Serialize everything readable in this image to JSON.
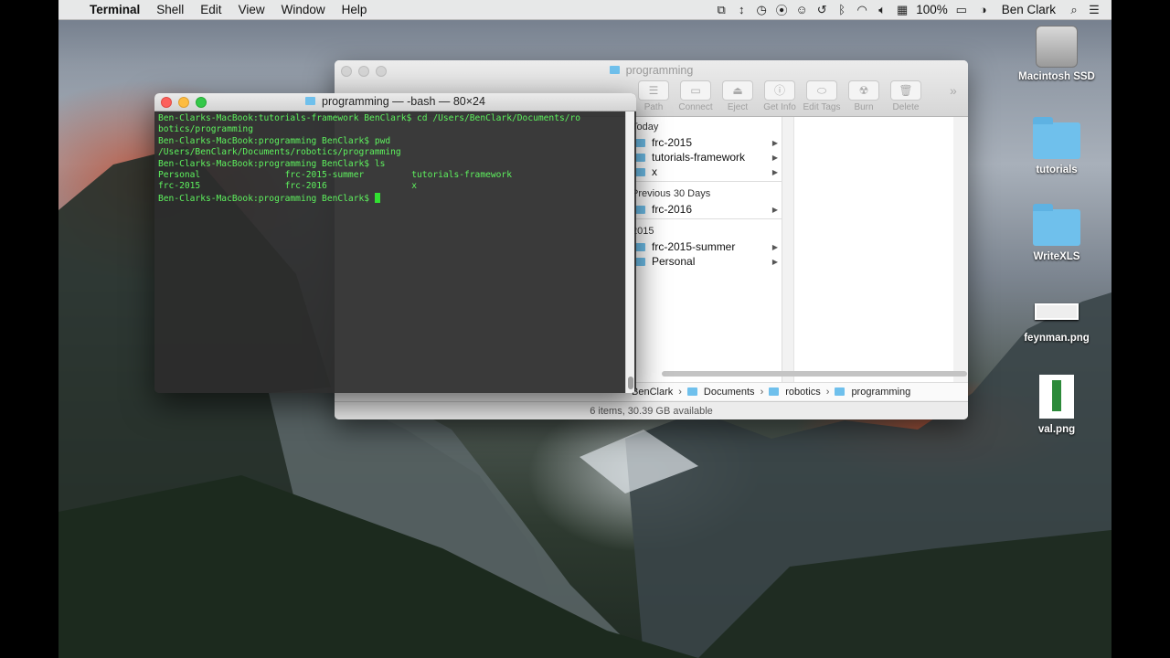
{
  "menubar": {
    "app": "Terminal",
    "items": [
      "Shell",
      "Edit",
      "View",
      "Window",
      "Help"
    ],
    "battery": "100%",
    "user": "Ben Clark"
  },
  "desktop": {
    "icons": [
      {
        "label": "Macintosh SSD",
        "kind": "drive"
      },
      {
        "label": "tutorials",
        "kind": "folder"
      },
      {
        "label": "WriteXLS",
        "kind": "folder"
      },
      {
        "label": "feynman.png",
        "kind": "image"
      },
      {
        "label": "val.png",
        "kind": "image"
      }
    ]
  },
  "finder": {
    "title": "programming",
    "tools": [
      "Path",
      "Connect",
      "Eject",
      "Get Info",
      "Edit Tags",
      "Burn",
      "Delete"
    ],
    "groups": [
      {
        "label": "Today",
        "items": [
          "frc-2015",
          "tutorials-framework",
          "x"
        ]
      },
      {
        "label": "Previous 30 Days",
        "items": [
          "frc-2016"
        ]
      },
      {
        "label": "2015",
        "items": [
          "frc-2015-summer",
          "Personal"
        ]
      }
    ],
    "path": [
      "BenClark",
      "Documents",
      "robotics",
      "programming"
    ],
    "status": "6 items, 30.39 GB available"
  },
  "terminal": {
    "title": "programming — -bash — 80×24",
    "lines": [
      "Ben-Clarks-MacBook:tutorials-framework BenClark$ cd /Users/BenClark/Documents/ro",
      "botics/programming",
      "Ben-Clarks-MacBook:programming BenClark$ pwd",
      "/Users/BenClark/Documents/robotics/programming",
      "Ben-Clarks-MacBook:programming BenClark$ ls",
      "Personal                frc-2015-summer         tutorials-framework",
      "frc-2015                frc-2016                x"
    ],
    "prompt": "Ben-Clarks-MacBook:programming BenClark$ "
  }
}
